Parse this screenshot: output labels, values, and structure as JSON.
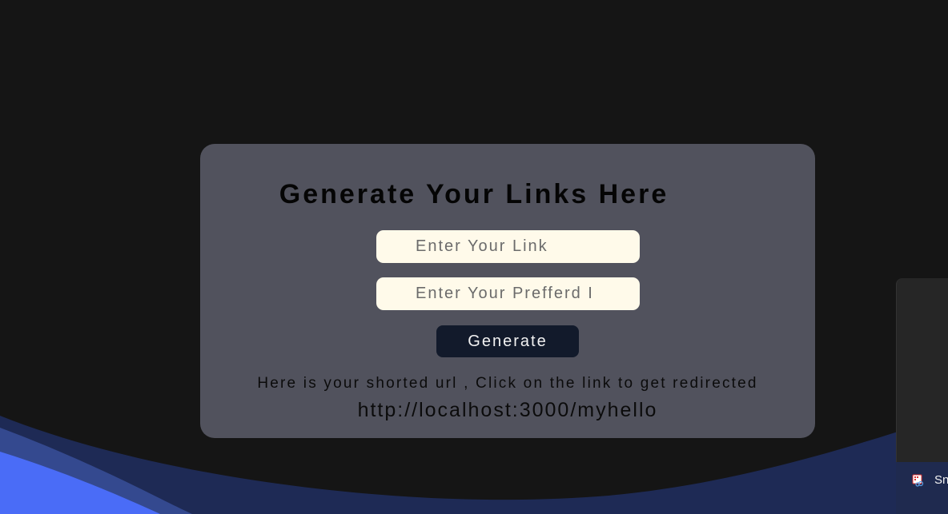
{
  "form": {
    "title": "Generate Your Links Here",
    "link_placeholder": "Enter Your Link",
    "alias_placeholder": "Enter Your Prefferd I",
    "generate_label": "Generate"
  },
  "result": {
    "message": "Here is your shorted url , Click on the link to get redirected",
    "short_url": "http://localhost:3000/myhello"
  },
  "taskbar": {
    "item_label": "Sn",
    "item_icon": "snipping-tool-icon"
  },
  "colors": {
    "background": "#151515",
    "card": "#51525d",
    "input": "#fffaea",
    "button": "#121a2b",
    "wave_primary": "#4a6cf7",
    "wave_secondary": "#2a3a7a"
  }
}
